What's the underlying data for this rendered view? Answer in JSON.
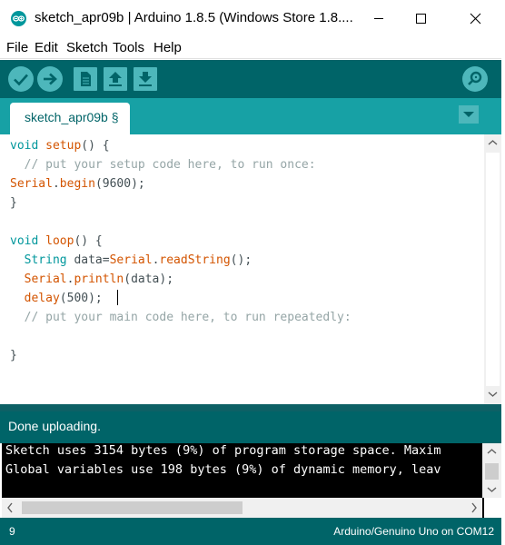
{
  "window": {
    "title": "sketch_apr09b | Arduino 1.8.5 (Windows Store 1.8....",
    "app_icon": "arduino-logo-icon",
    "controls": [
      "minimize-icon",
      "maximize-icon",
      "close-icon"
    ]
  },
  "menu": {
    "items": [
      "File",
      "Edit",
      "Sketch",
      "Tools",
      "Help"
    ]
  },
  "toolbar": {
    "buttons": [
      {
        "name": "verify",
        "icon": "check-icon"
      },
      {
        "name": "upload",
        "icon": "arrow-right-icon"
      },
      {
        "name": "new",
        "icon": "file-icon"
      },
      {
        "name": "open",
        "icon": "arrow-up-icon"
      },
      {
        "name": "save",
        "icon": "arrow-down-icon"
      }
    ],
    "serial_monitor_icon": "magnifier-icon"
  },
  "tabs": {
    "active_label": "sketch_apr09b §",
    "menu_icon": "triangle-down-icon"
  },
  "editor": {
    "lines": [
      "void setup() {",
      "  // put your setup code here, to run once:",
      "Serial.begin(9600);",
      "}",
      "",
      "void loop() {",
      "  String data=Serial.readString();",
      "  Serial.println(data);",
      "  delay(500);",
      "  // put your main code here, to run repeatedly:",
      "",
      "}"
    ],
    "tokens": {
      "void": "void",
      "setup": "setup",
      "open_paren_brace": "() {",
      "comment1": "// put your setup code here, to run once:",
      "serial": "Serial",
      "begin": "begin",
      "begin_args": "(9600);",
      "close_brace": "}",
      "loop": "loop",
      "string": "String",
      "data_eq": " data=",
      "read_string": "readString",
      "empty_call": "();",
      "println": "println",
      "println_args": "(data);",
      "delay": "delay",
      "delay_args": "(500);",
      "comment2": "// put your main code here, to run repeatedly:",
      "dot": "."
    },
    "colors": {
      "keyword": "#00979c",
      "function": "#d35400",
      "comment": "#95a5a6",
      "text": "#434f54"
    }
  },
  "status": {
    "message": "Done uploading."
  },
  "console": {
    "lines": [
      "Sketch uses 3154 bytes (9%) of program storage space. Maxim",
      "Global variables use 198 bytes (9%) of dynamic memory, leav"
    ]
  },
  "footer": {
    "line_number": "9",
    "board": "Arduino/Genuino Uno on COM12"
  },
  "theme": {
    "dark_teal": "#006468",
    "teal": "#17a1a5",
    "button_teal": "#4db7bb"
  }
}
